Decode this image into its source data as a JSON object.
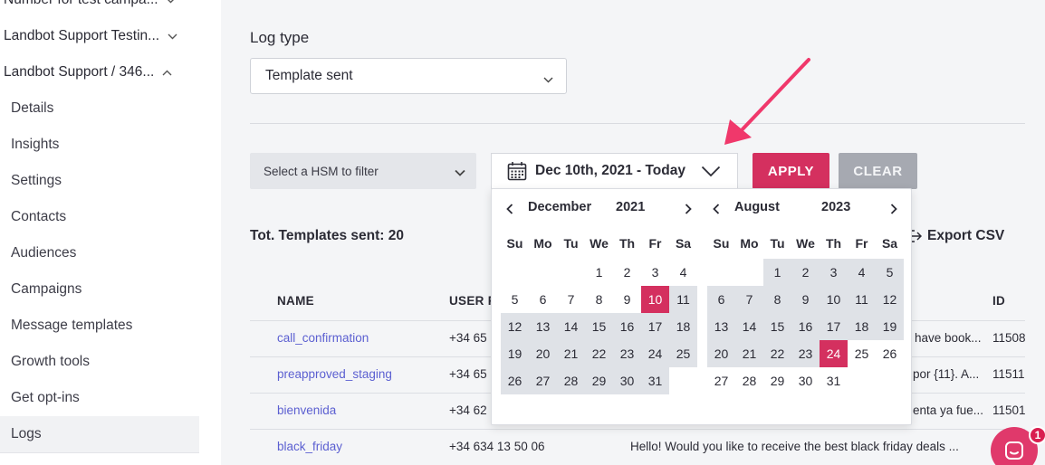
{
  "sidebar": {
    "groups": [
      {
        "label": "Number for test campa...",
        "expanded": false
      },
      {
        "label": "Landbot Support Testin...",
        "expanded": false
      },
      {
        "label": "Landbot Support / 346...",
        "expanded": true
      }
    ],
    "items": [
      {
        "label": "Details"
      },
      {
        "label": "Insights"
      },
      {
        "label": "Settings"
      },
      {
        "label": "Contacts"
      },
      {
        "label": "Audiences"
      },
      {
        "label": "Campaigns"
      },
      {
        "label": "Message templates"
      },
      {
        "label": "Growth tools"
      },
      {
        "label": "Get opt-ins"
      },
      {
        "label": "Logs",
        "active": true
      }
    ]
  },
  "filters": {
    "log_type_label": "Log type",
    "log_type_value": "Template sent",
    "hsm_placeholder": "Select a HSM to filter",
    "date_range": "Dec 10th, 2021 - Today",
    "apply_label": "APPLY",
    "clear_label": "CLEAR"
  },
  "summary": {
    "total_text": "Tot. Templates sent: 20",
    "export_label": "Export CSV"
  },
  "table": {
    "headers": {
      "name": "NAME",
      "user": "USER P",
      "id": "ID"
    },
    "rows": [
      {
        "name": "call_confirmation",
        "phone": "+34 65",
        "message": "have book...",
        "id": "11508"
      },
      {
        "name": "preapproved_staging",
        "phone": "+34 65",
        "message": "por {11}. A...",
        "id": "11511"
      },
      {
        "name": "bienvenida",
        "phone": "+34 62",
        "message": "enta ya fue...",
        "id": "11501"
      },
      {
        "name": "black_friday",
        "phone": "+34 634 13 50 06",
        "message": "Hello! Would you like to receive the best black friday deals ...",
        "id": ""
      }
    ]
  },
  "calendar": {
    "weekdays": [
      "Su",
      "Mo",
      "Tu",
      "We",
      "Th",
      "Fr",
      "Sa"
    ],
    "left": {
      "month": "December",
      "year": "2021",
      "weeks": [
        [
          "",
          "",
          "",
          "1",
          "2",
          "3",
          "4"
        ],
        [
          "5",
          "6",
          "7",
          "8",
          "9",
          "10",
          "11"
        ],
        [
          "12",
          "13",
          "14",
          "15",
          "16",
          "17",
          "18"
        ],
        [
          "19",
          "20",
          "21",
          "22",
          "23",
          "24",
          "25"
        ],
        [
          "26",
          "27",
          "28",
          "29",
          "30",
          "31",
          ""
        ]
      ]
    },
    "right": {
      "month": "August",
      "year": "2023",
      "weeks": [
        [
          "",
          "",
          "1",
          "2",
          "3",
          "4",
          "5"
        ],
        [
          "6",
          "7",
          "8",
          "9",
          "10",
          "11",
          "12"
        ],
        [
          "13",
          "14",
          "15",
          "16",
          "17",
          "18",
          "19"
        ],
        [
          "20",
          "21",
          "22",
          "23",
          "24",
          "25",
          "26"
        ],
        [
          "27",
          "28",
          "29",
          "30",
          "31",
          "",
          ""
        ]
      ]
    },
    "selected_start": "December 10, 2021",
    "selected_end": "August 24, 2023"
  },
  "chat_widget": {
    "badge_count": "1"
  },
  "colors": {
    "accent": "#d4305f",
    "range_fill": "#dfe2e7",
    "link": "#5b5fd1",
    "annotation_arrow": "#f0386b"
  }
}
